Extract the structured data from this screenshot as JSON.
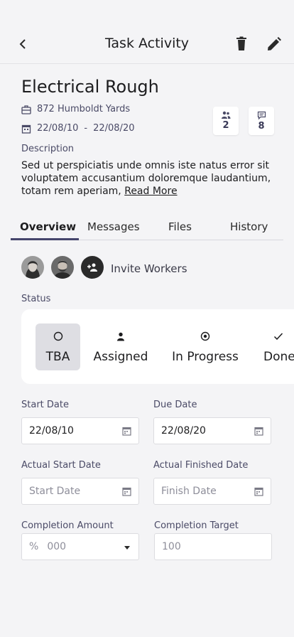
{
  "header": {
    "title": "Task Activity",
    "back_icon": "chevron-left-icon",
    "delete_icon": "trash-icon",
    "edit_icon": "pencil-icon"
  },
  "task": {
    "title": "Electrical Rough",
    "address": "872 Humboldt Yards",
    "start_date": "22/08/10",
    "date_separator": "-",
    "end_date": "22/08/20",
    "workers_count": "2",
    "messages_count": "8"
  },
  "description": {
    "label": "Description",
    "text": "Sed ut perspiciatis unde omnis iste natus error sit voluptatem accusantium doloremque laudantium, totam rem aperiam,",
    "read_more": "Read More"
  },
  "tabs": [
    {
      "label": "Overview",
      "active": true
    },
    {
      "label": "Messages"
    },
    {
      "label": "Files"
    },
    {
      "label": "History"
    }
  ],
  "workers": {
    "invite_label": "Invite Workers"
  },
  "status": {
    "label": "Status",
    "options": [
      {
        "label": "TBA",
        "icon": "circle-outline-icon",
        "selected": true
      },
      {
        "label": "Assigned",
        "icon": "person-icon"
      },
      {
        "label": "In Progress",
        "icon": "radio-dot-icon"
      },
      {
        "label": "Done",
        "icon": "check-icon"
      }
    ]
  },
  "dates": {
    "start_label": "Start Date",
    "start_value": "22/08/10",
    "due_label": "Due Date",
    "due_value": "22/08/20",
    "actual_start_label": "Actual Start Date",
    "actual_start_placeholder": "Start Date",
    "actual_finish_label": "Actual Finished Date",
    "actual_finish_placeholder": "Finish Date"
  },
  "completion": {
    "amount_label": "Completion Amount",
    "amount_unit": "%",
    "amount_placeholder": "000",
    "target_label": "Completion Target",
    "target_placeholder": "100"
  },
  "colors": {
    "accent": "#45456b",
    "background": "#f4f4f6",
    "selected_status": "#dedee3"
  }
}
